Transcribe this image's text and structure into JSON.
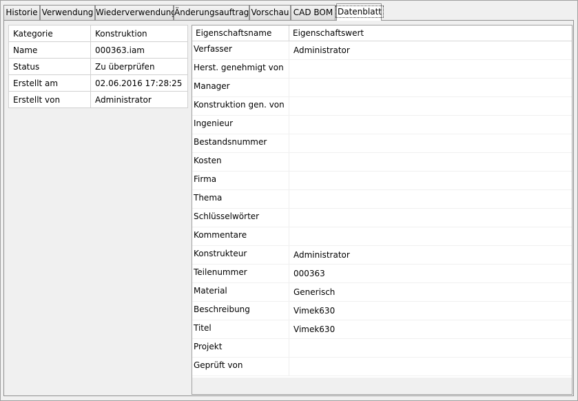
{
  "tabs": [
    {
      "label": "Historie"
    },
    {
      "label": "Verwendung"
    },
    {
      "label": "Wiederverwendung"
    },
    {
      "label": "Änderungsauftrag"
    },
    {
      "label": "Vorschau"
    },
    {
      "label": "CAD BOM"
    },
    {
      "label": "Datenblatt",
      "active": true
    }
  ],
  "info": [
    {
      "key": "Kategorie",
      "value": "Konstruktion"
    },
    {
      "key": "Name",
      "value": "000363.iam"
    },
    {
      "key": "Status",
      "value": "Zu überprüfen"
    },
    {
      "key": "Erstellt am",
      "value": "02.06.2016 17:28:25"
    },
    {
      "key": "Erstellt von",
      "value": "Administrator"
    }
  ],
  "grid": {
    "header_name": "Eigenschaftsname",
    "header_value": "Eigenschaftswert",
    "rows": [
      {
        "name": "Verfasser",
        "value": "Administrator"
      },
      {
        "name": "Herst. genehmigt von",
        "value": ""
      },
      {
        "name": "Manager",
        "value": ""
      },
      {
        "name": "Konstruktion gen. von",
        "value": ""
      },
      {
        "name": "Ingenieur",
        "value": ""
      },
      {
        "name": "Bestandsnummer",
        "value": ""
      },
      {
        "name": "Kosten",
        "value": ""
      },
      {
        "name": "Firma",
        "value": ""
      },
      {
        "name": "Thema",
        "value": ""
      },
      {
        "name": "Schlüsselwörter",
        "value": ""
      },
      {
        "name": "Kommentare",
        "value": ""
      },
      {
        "name": "Konstrukteur",
        "value": "Administrator"
      },
      {
        "name": "Teilenummer",
        "value": "000363"
      },
      {
        "name": "Material",
        "value": "Generisch"
      },
      {
        "name": "Beschreibung",
        "value": "Vimek630"
      },
      {
        "name": "Titel",
        "value": "Vimek630"
      },
      {
        "name": "Projekt",
        "value": ""
      },
      {
        "name": "Geprüft von",
        "value": ""
      }
    ]
  }
}
